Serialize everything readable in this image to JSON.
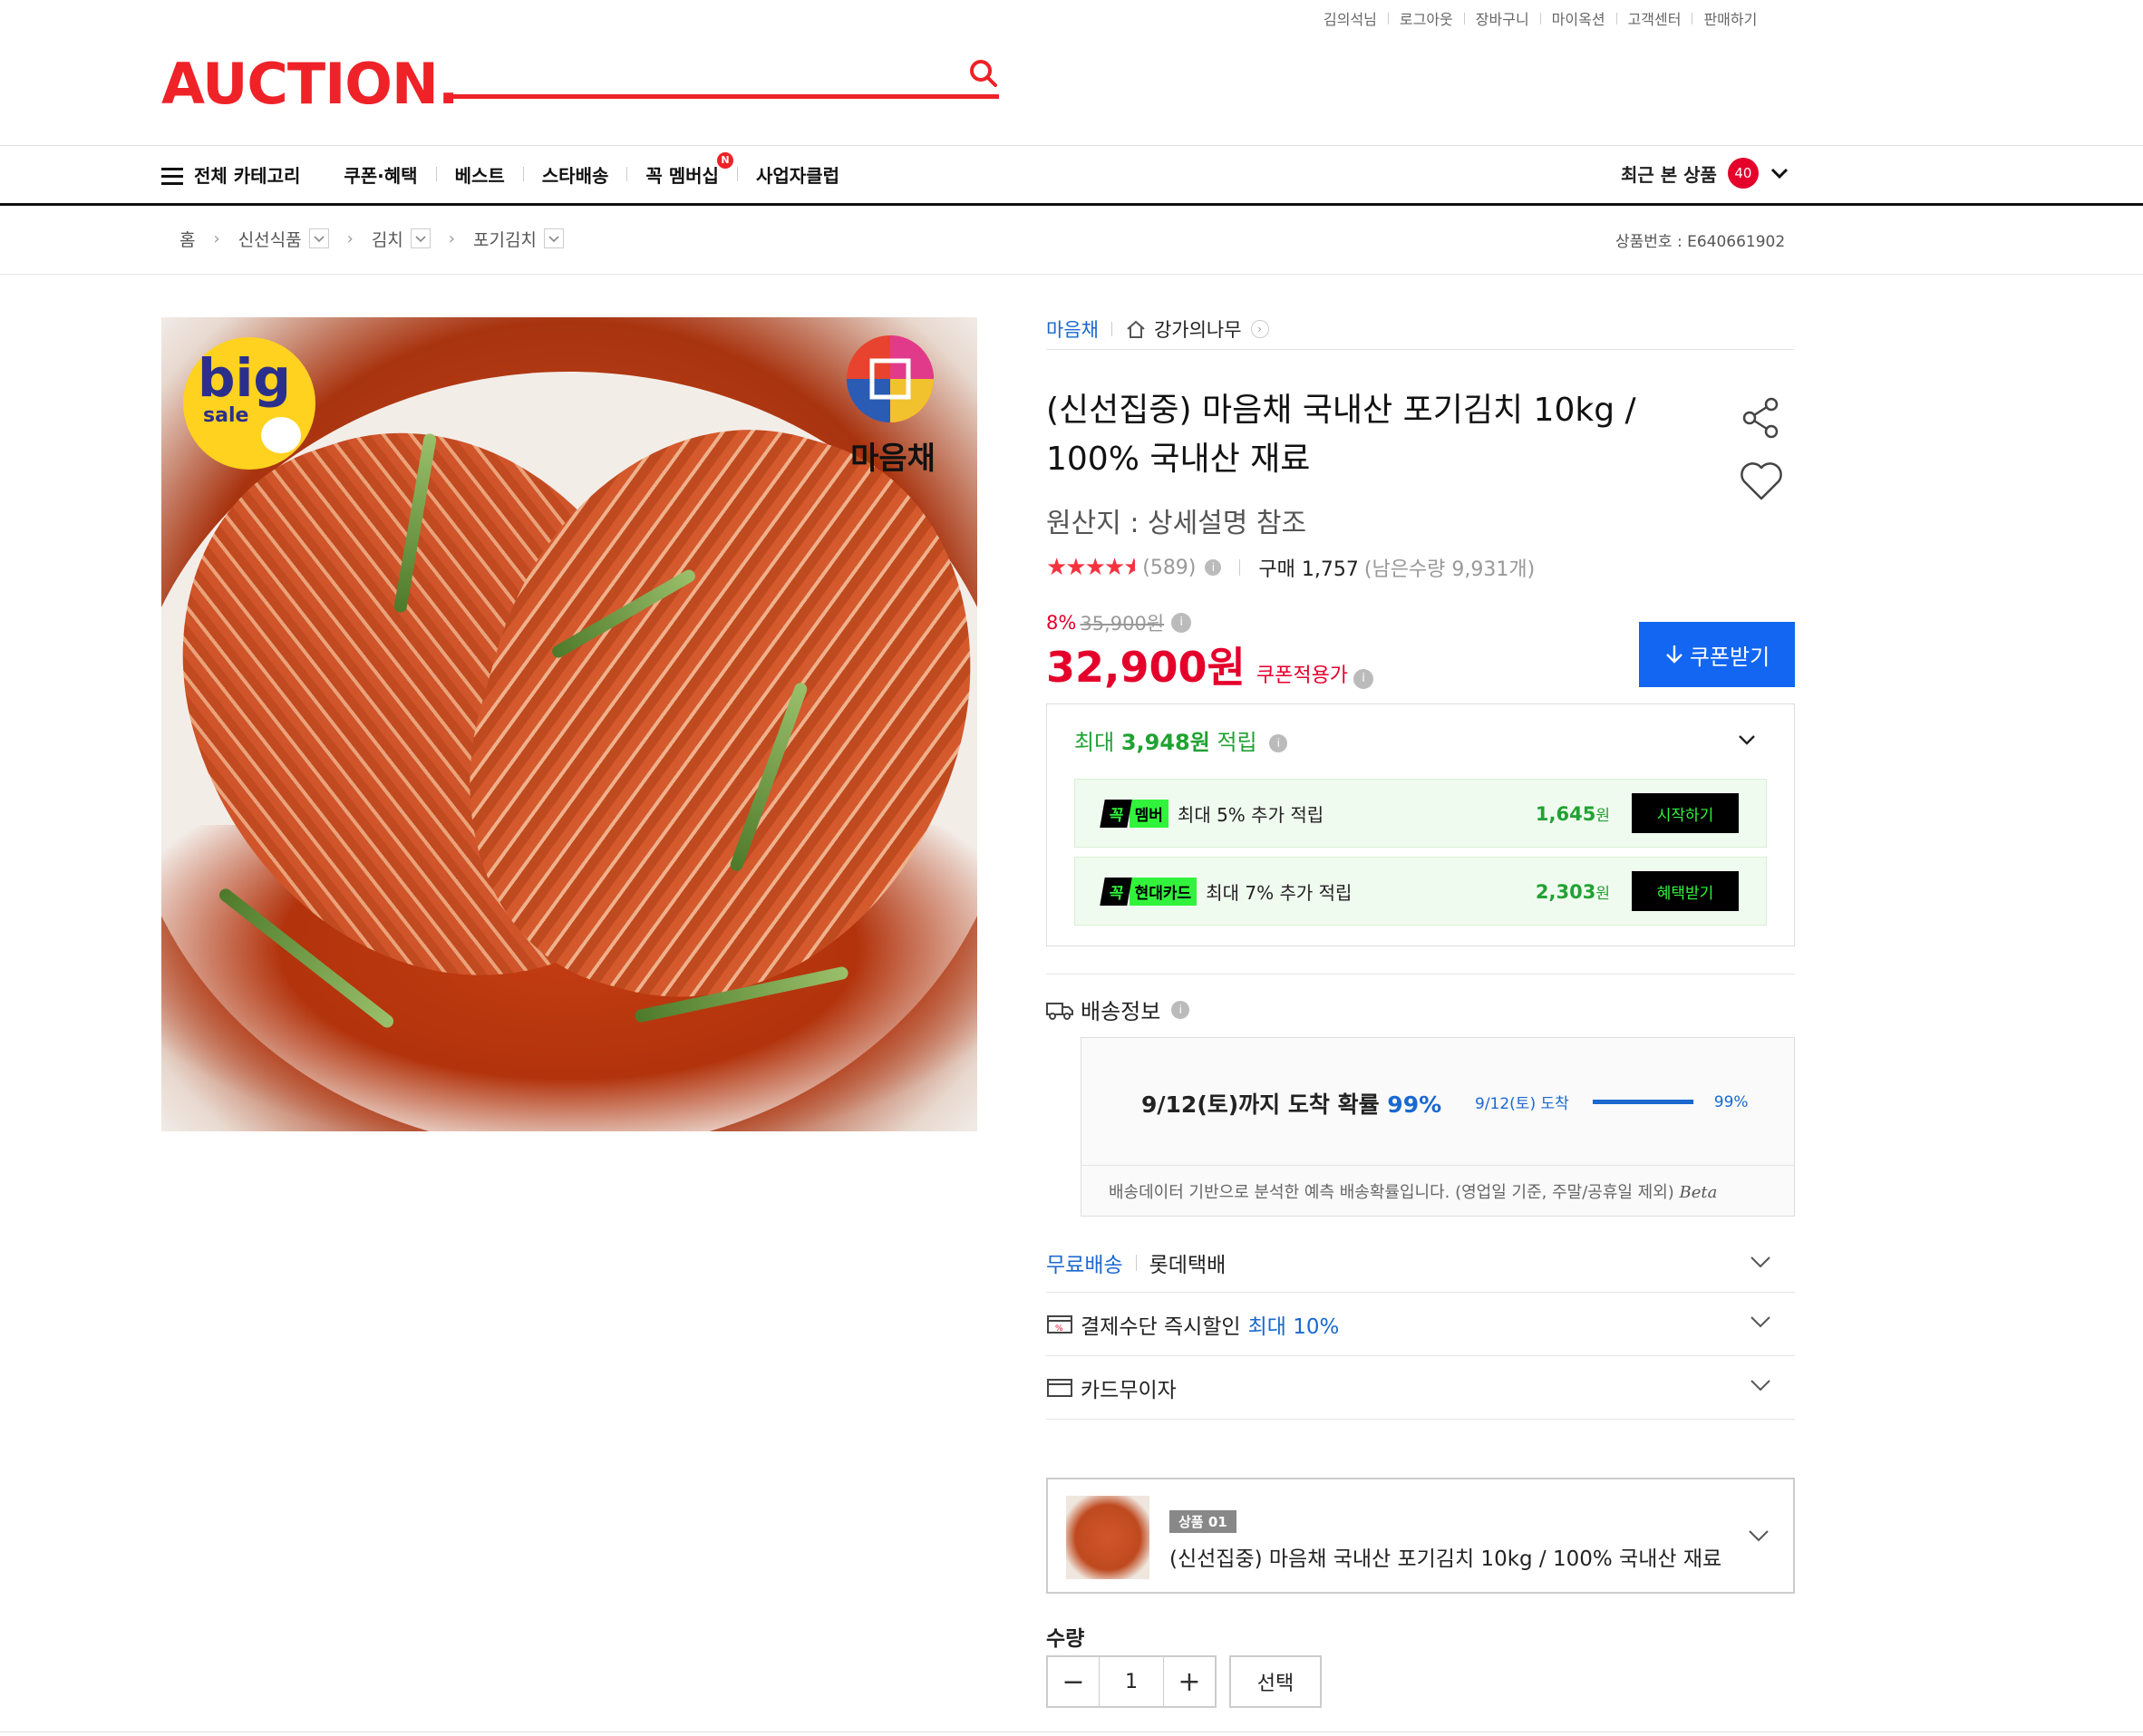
{
  "topbar": {
    "items": [
      "김의석님",
      "로그아웃",
      "장바구니",
      "마이옥션",
      "고객센터",
      "판매하기"
    ]
  },
  "logo": "AUCTION.",
  "gnb": {
    "all_category": "전체 카테고리",
    "items": [
      "쿠폰·혜택",
      "베스트",
      "스타배송",
      "꼭 멤버십",
      "사업자클럽"
    ],
    "new_badge": "N",
    "recent_label": "최근 본 상품",
    "recent_count": "40"
  },
  "breadcrumb": {
    "home": "홈",
    "items": [
      "신선식품",
      "김치",
      "포기김치"
    ]
  },
  "product_no": "상품번호 : E640661902",
  "image": {
    "sale_big": "big",
    "sale_small": "sale",
    "brand": "마음채"
  },
  "seller": {
    "brand": "마음채",
    "shop": "강가의나무"
  },
  "product": {
    "title": "(신선집중) 마음채 국내산 포기김치 10kg / 100% 국내산 재료",
    "origin": "원산지 : 상세설명 참조",
    "rating_stars": 4.5,
    "review_count": "(589)",
    "purchase": "구매 1,757",
    "remaining": "(남은수량 9,931개)",
    "discount_pct": "8%",
    "original_price": "35,900원",
    "price": "32,900원",
    "price_label": "쿠폰적용가",
    "coupon_button": "쿠폰받기"
  },
  "points": {
    "prefix": "최대",
    "amount": "3,948원",
    "suffix": "적립",
    "rows": [
      {
        "tag_k": "꼭",
        "tag_t": "멤버",
        "desc": "최대 5% 추가 적립",
        "amount": "1,645",
        "unit": "원",
        "button": "시작하기"
      },
      {
        "tag_k": "꼭",
        "tag_t": "현대카드",
        "desc": "최대 7% 추가 적립",
        "amount": "2,303",
        "unit": "원",
        "button": "혜택받기"
      }
    ]
  },
  "shipping": {
    "label": "배송정보",
    "headline": "9/12(토)까지 도착 확률",
    "headline_pct": "99%",
    "bar_label": "9/12(토) 도착",
    "bar_pct_label": "99%",
    "bar_fraction": 0.99,
    "note": "배송데이터 기반으로 분석한 예측 배송확률입니다. (영업일 기준, 주말/공휴일 제외)",
    "beta": "Beta"
  },
  "accordions": {
    "free_ship": "무료배송",
    "courier": "롯데택배",
    "pay_discount": "결제수단 즉시할인",
    "pay_discount_max": "최대 10%",
    "card_installment": "카드무이자"
  },
  "option": {
    "badge": "상품 01",
    "name": "(신선집중) 마음채 국내산 포기김치 10kg / 100% 국내산 재료"
  },
  "quantity": {
    "label": "수량",
    "value": "1",
    "minus": "−",
    "plus": "+",
    "select": "선택"
  },
  "colors": {
    "brand_red": "#ee2227",
    "price_red": "#e4002b",
    "coupon_blue": "#1266f1",
    "point_green": "#21a233",
    "neon_green": "#31f33c"
  }
}
